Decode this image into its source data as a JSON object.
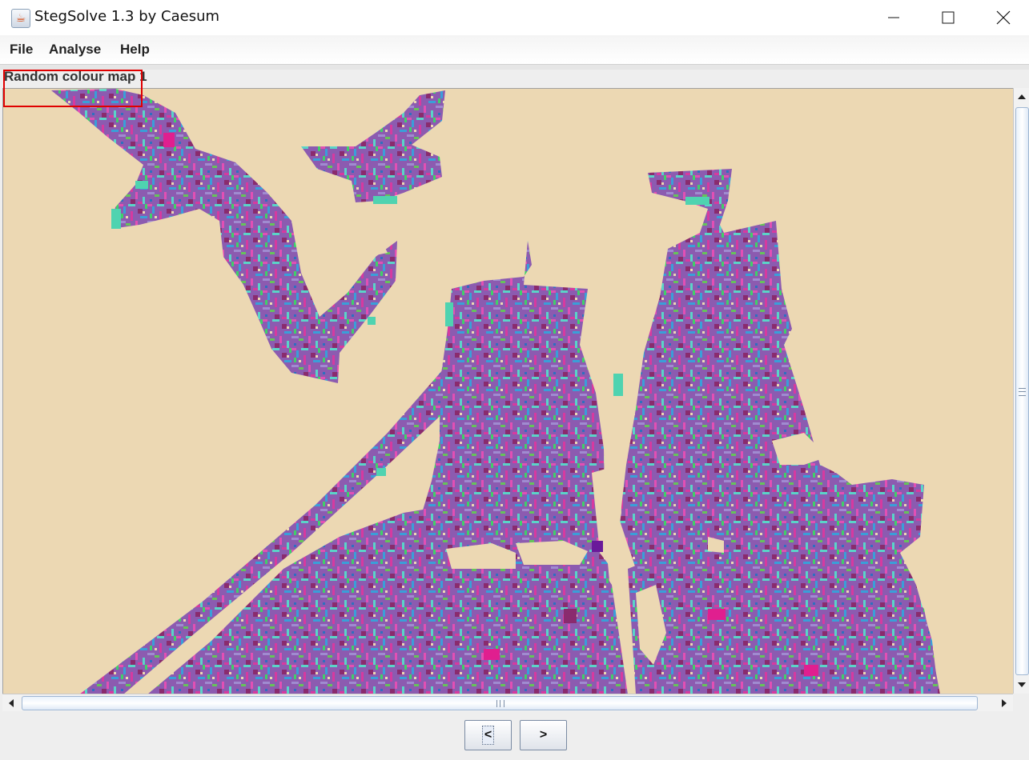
{
  "window": {
    "title": "StegSolve 1.3 by Caesum",
    "icon": "java-cup-icon",
    "controls": [
      "minimize-icon",
      "maximize-icon",
      "close-icon"
    ]
  },
  "menubar": {
    "items": [
      {
        "label": "File"
      },
      {
        "label": "Analyse"
      },
      {
        "label": "Help"
      }
    ]
  },
  "image": {
    "label": "Random colour map 1",
    "background_color": "#ecd8b3",
    "noise_colors": [
      "#e24fb4",
      "#8c5bb0",
      "#3a9fd8",
      "#5ad4c8",
      "#3fd06a",
      "#8a2b6e",
      "#d63aa0",
      "#a08bd0",
      "#66c35a",
      "#2f6fc0"
    ]
  },
  "navigation": {
    "prev_label": "<",
    "next_label": ">"
  },
  "colors": {
    "highlight": "#e00000",
    "scrollbar_thumb_border": "#9fb6d2"
  }
}
